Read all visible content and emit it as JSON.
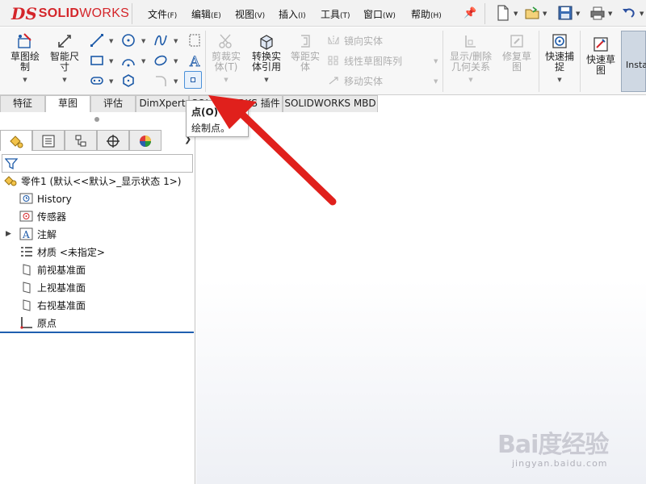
{
  "app": {
    "logo_mark": "DS",
    "logo_text_bold": "SOLID",
    "logo_text_light": "WORKS"
  },
  "menu": [
    {
      "label": "文件",
      "key": "(F)"
    },
    {
      "label": "编辑",
      "key": "(E)"
    },
    {
      "label": "视图",
      "key": "(V)"
    },
    {
      "label": "插入",
      "key": "(I)"
    },
    {
      "label": "工具",
      "key": "(T)"
    },
    {
      "label": "窗口",
      "key": "(W)"
    },
    {
      "label": "帮助",
      "key": "(H)"
    }
  ],
  "ribbon": {
    "sketch": "草图绘\n制",
    "smart_dim": "智能尺\n寸",
    "trim": "剪裁实\n体(T)",
    "convert": "转换实\n体引用",
    "offset": "等距实\n体",
    "mirror": "镜向实体",
    "linear_pattern": "线性草图阵列",
    "move": "移动实体",
    "display_relations": "显示/删除\n几何关系",
    "repair": "修复草\n图",
    "quick_snap": "快速捕\n捉",
    "rapid_sketch": "快速草\n图",
    "instant": "Insta"
  },
  "tabs": [
    {
      "label": "特征"
    },
    {
      "label": "草图"
    },
    {
      "label": "评估"
    },
    {
      "label": "DimXpert"
    },
    {
      "label": "SOLIDWORKS 插件"
    },
    {
      "label": "SOLIDWORKS MBD"
    }
  ],
  "tooltip": {
    "title": "点(O)",
    "desc": "绘制点。"
  },
  "tree": {
    "root": "零件1 (默认<<默认>_显示状态 1>)",
    "items": [
      {
        "label": "History"
      },
      {
        "label": "传感器"
      },
      {
        "label": "注解"
      },
      {
        "label": "材质 <未指定>"
      },
      {
        "label": "前视基准面"
      },
      {
        "label": "上视基准面"
      },
      {
        "label": "右视基准面"
      },
      {
        "label": "原点"
      }
    ]
  },
  "watermark": {
    "brand": "Bai度经验",
    "url": "jingyan.baidu.com"
  },
  "colors": {
    "brand_red": "#d4252a",
    "arrow_red": "#e0201c",
    "selection_blue": "#1f5fb0"
  }
}
